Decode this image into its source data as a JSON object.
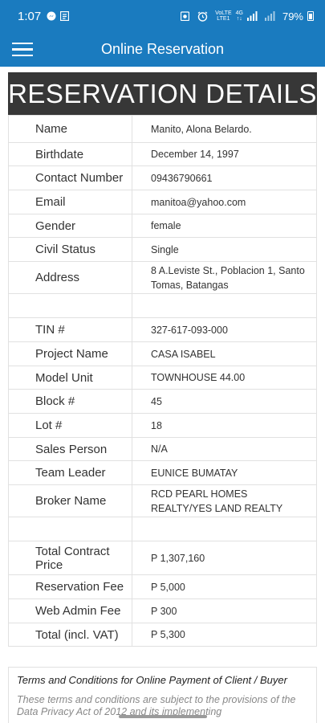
{
  "status_bar": {
    "time": "1:07",
    "battery": "79%",
    "network_label": "VoLTE 4G",
    "icons": [
      "messenger-icon",
      "notes-icon",
      "alarm-icon",
      "signal-icon",
      "battery-icon"
    ]
  },
  "app_bar": {
    "title": "Online Reservation",
    "menu_icon": "hamburger-menu-icon"
  },
  "banner": "RESERVATION DETAILS",
  "rows": [
    {
      "label": "Name",
      "value": "Manito, Alona Belardo."
    },
    {
      "label": "Birthdate",
      "value": "December 14, 1997"
    },
    {
      "label": "Contact Number",
      "value": "09436790661"
    },
    {
      "label": "Email",
      "value": "manitoa@yahoo.com"
    },
    {
      "label": "Gender",
      "value": "female"
    },
    {
      "label": "Civil Status",
      "value": "Single"
    },
    {
      "label": "Address",
      "value": "8 A.Leviste St., Poblacion 1, Santo Tomas, Batangas"
    },
    {
      "label": "",
      "value": ""
    },
    {
      "label": "TIN #",
      "value": "327-617-093-000"
    },
    {
      "label": "Project Name",
      "value": "CASA ISABEL"
    },
    {
      "label": "Model Unit",
      "value": "TOWNHOUSE 44.00"
    },
    {
      "label": "Block #",
      "value": "45"
    },
    {
      "label": "Lot #",
      "value": "18"
    },
    {
      "label": "Sales Person",
      "value": "N/A"
    },
    {
      "label": "Team Leader",
      "value": "EUNICE BUMATAY"
    },
    {
      "label": "Broker Name",
      "value": "RCD PEARL HOMES REALTY/YES LAND REALTY"
    },
    {
      "label": "",
      "value": ""
    },
    {
      "label": "Total Contract Price",
      "value": "P 1,307,160"
    },
    {
      "label": "Reservation Fee",
      "value": "P 5,000"
    },
    {
      "label": "Web Admin Fee",
      "value": "P 300"
    },
    {
      "label": "Total (incl. VAT)",
      "value": "P 5,300"
    }
  ],
  "terms": {
    "title": "Terms and Conditions for Online Payment of Client / Buyer",
    "body": "These terms and conditions are subject to the provisions of the Data Privacy Act of 2012 and its implementing"
  }
}
